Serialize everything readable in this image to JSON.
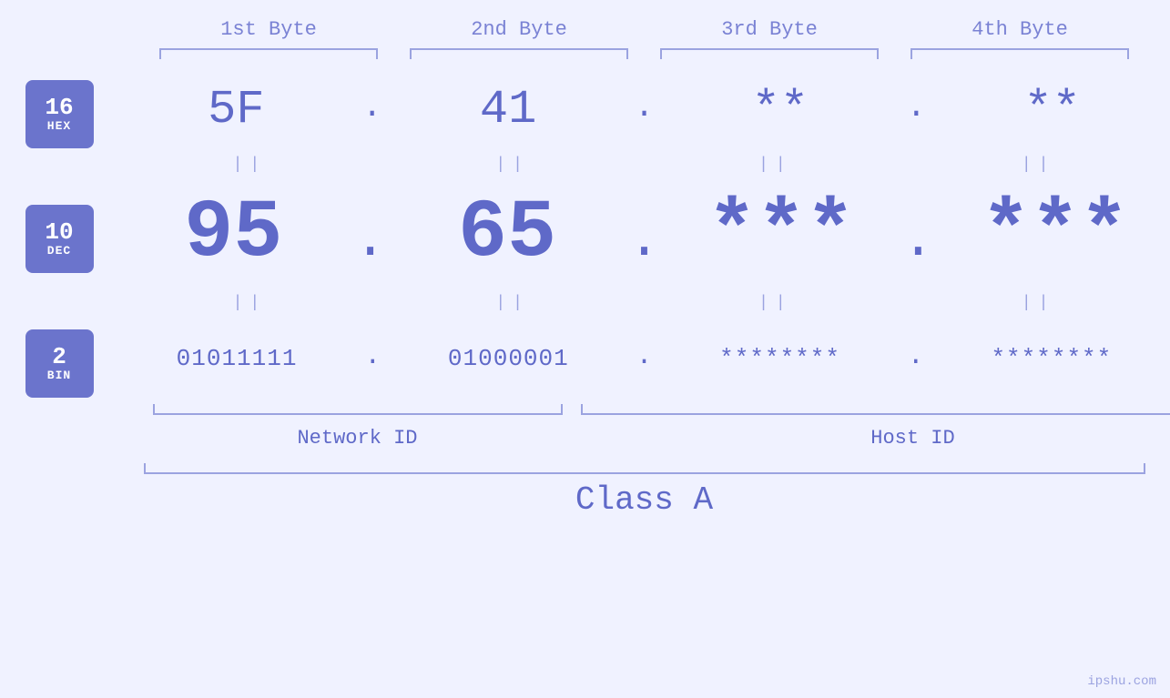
{
  "headers": {
    "byte1": "1st Byte",
    "byte2": "2nd Byte",
    "byte3": "3rd Byte",
    "byte4": "4th Byte"
  },
  "bases": {
    "hex": {
      "num": "16",
      "base": "HEX"
    },
    "dec": {
      "num": "10",
      "base": "DEC"
    },
    "bin": {
      "num": "2",
      "base": "BIN"
    }
  },
  "values": {
    "hex": {
      "b1": "5F",
      "b2": "41",
      "b3": "**",
      "b4": "**"
    },
    "dec": {
      "b1": "95",
      "b2": "65",
      "b3": "***",
      "b4": "***"
    },
    "bin": {
      "b1": "01011111",
      "b2": "01000001",
      "b3": "********",
      "b4": "********"
    }
  },
  "separators": {
    "equals": "||"
  },
  "dots": {
    "dot": "."
  },
  "labels": {
    "networkID": "Network ID",
    "hostID": "Host ID",
    "classA": "Class A"
  },
  "watermark": "ipshu.com"
}
